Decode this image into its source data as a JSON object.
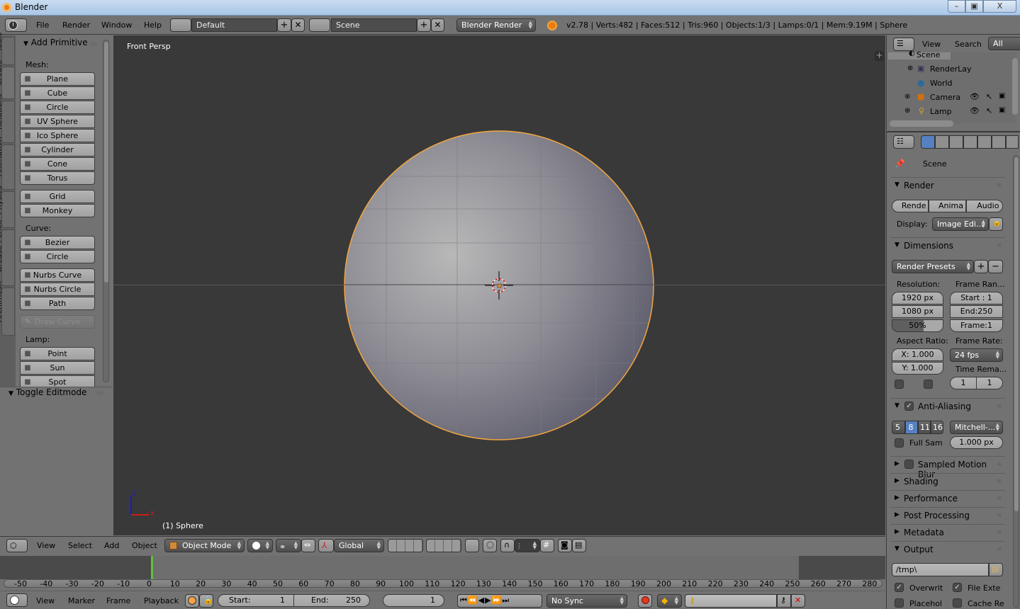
{
  "window": {
    "title": "Blender",
    "controls": {
      "minimize": "–",
      "maximize": "▣",
      "close": "X"
    }
  },
  "info_header": {
    "menus": [
      "File",
      "Render",
      "Window",
      "Help"
    ],
    "screen_layout": "Default",
    "scene": "Scene",
    "render_engine": "Blender Render",
    "stats": "v2.78 | Verts:482 | Faces:512 | Tris:960 | Objects:1/3 | Lamps:0/1 | Mem:9.19M | Sphere"
  },
  "tool_tabs": [
    "Tools",
    "Create",
    "Relations",
    "Animation",
    "Physics",
    "Grease Pencil",
    "Archimesh"
  ],
  "tool_tabs_active": "Create",
  "tool_shelf": {
    "panel_title": "Add Primitive",
    "mesh_label": "Mesh:",
    "mesh_group1": [
      {
        "label": "Plane",
        "icon": "plane-icon"
      },
      {
        "label": "Cube",
        "icon": "cube-icon"
      },
      {
        "label": "Circle",
        "icon": "circle-icon"
      },
      {
        "label": "UV Sphere",
        "icon": "uv-sphere-icon"
      },
      {
        "label": "Ico Sphere",
        "icon": "ico-sphere-icon"
      },
      {
        "label": "Cylinder",
        "icon": "cylinder-icon"
      },
      {
        "label": "Cone",
        "icon": "cone-icon"
      },
      {
        "label": "Torus",
        "icon": "torus-icon"
      }
    ],
    "mesh_group2": [
      {
        "label": "Grid",
        "icon": "grid-icon"
      },
      {
        "label": "Monkey",
        "icon": "monkey-icon"
      }
    ],
    "curve_label": "Curve:",
    "curve_group1": [
      {
        "label": "Bezier",
        "icon": "bezier-icon"
      },
      {
        "label": "Circle",
        "icon": "bezier-circle-icon"
      }
    ],
    "curve_group2": [
      {
        "label": "Nurbs Curve",
        "icon": "nurbs-curve-icon"
      },
      {
        "label": "Nurbs Circle",
        "icon": "nurbs-circle-icon"
      },
      {
        "label": "Path",
        "icon": "path-icon"
      }
    ],
    "draw_curve": "Draw Curve",
    "lamp_label": "Lamp:",
    "lamp_group": [
      {
        "label": "Point",
        "icon": "point-lamp-icon"
      },
      {
        "label": "Sun",
        "icon": "sun-lamp-icon"
      },
      {
        "label": "Spot",
        "icon": "spot-lamp-icon"
      }
    ],
    "toggle_editmode": "Toggle Editmode"
  },
  "viewport": {
    "view_name": "Front Persp",
    "object_info": "(1) Sphere",
    "axis_z": "Z",
    "axis_x": "X"
  },
  "view3d_header": {
    "menus": [
      "View",
      "Select",
      "Add",
      "Object"
    ],
    "mode": "Object Mode",
    "orientation": "Global"
  },
  "timeline": {
    "ticks": [
      -50,
      -40,
      -30,
      -20,
      -10,
      0,
      10,
      20,
      30,
      40,
      50,
      60,
      70,
      80,
      90,
      100,
      110,
      120,
      130,
      140,
      150,
      160,
      170,
      180,
      190,
      200,
      210,
      220,
      230,
      240,
      250,
      260,
      270,
      280
    ],
    "current_frame": 1,
    "menus": [
      "View",
      "Marker",
      "Frame",
      "Playback"
    ],
    "start_label": "Start:",
    "start": "1",
    "end_label": "End:",
    "end": "250",
    "frame": "1",
    "sync": "No Sync"
  },
  "outliner": {
    "menus": [
      "View",
      "Search"
    ],
    "filter": "All Scen",
    "items": [
      {
        "label": "Scene",
        "icon": "scene-icon"
      },
      {
        "label": "RenderLay",
        "icon": "render-layers-icon"
      },
      {
        "label": "World",
        "icon": "world-icon"
      },
      {
        "label": "Camera",
        "icon": "camera-icon"
      },
      {
        "label": "Lamp",
        "icon": "lamp-icon"
      }
    ]
  },
  "properties": {
    "context": "Scene",
    "render": {
      "title": "Render",
      "buttons": [
        "Rende",
        "Anima",
        "Audio"
      ],
      "display_label": "Display:",
      "display_value": "Image Edi..."
    },
    "dimensions": {
      "title": "Dimensions",
      "presets": "Render Presets",
      "resolution_label": "Resolution:",
      "res_x": "1920 px",
      "res_y": "1080 px",
      "res_pct": "50%",
      "res_pct_value": 0.5,
      "frame_range_label": "Frame Ran...",
      "start": "Start : 1",
      "end": "End:250",
      "frame": "Frame:1",
      "aspect_label": "Aspect Ratio:",
      "aspect_x": "X: 1.000",
      "aspect_y": "Y: 1.000",
      "frame_rate_label": "Frame Rate:",
      "fps": "24 fps",
      "time_remap_label": "Time Rema...",
      "remap_old": "1",
      "remap_new": "1"
    },
    "anti_aliasing": {
      "title": "Anti-Aliasing",
      "enabled": true,
      "samples": [
        "5",
        "8",
        "11",
        "16"
      ],
      "selected": "8",
      "filter": "Mitchell-...",
      "full_sample": "Full Sam",
      "size": "1.000 px"
    },
    "collapsed_sections": [
      "Sampled Motion Blur",
      "Shading",
      "Performance",
      "Post Processing",
      "Metadata"
    ],
    "output": {
      "title": "Output",
      "path": "/tmp\\",
      "overwrite": "Overwrit",
      "file_ext": "File Exte",
      "placeholders": "Placehol",
      "cache": "Cache Re"
    }
  },
  "colors": {
    "accent_blue": "#5680c2",
    "selection_orange": "#f2a640",
    "current_frame_green": "#60c040"
  }
}
